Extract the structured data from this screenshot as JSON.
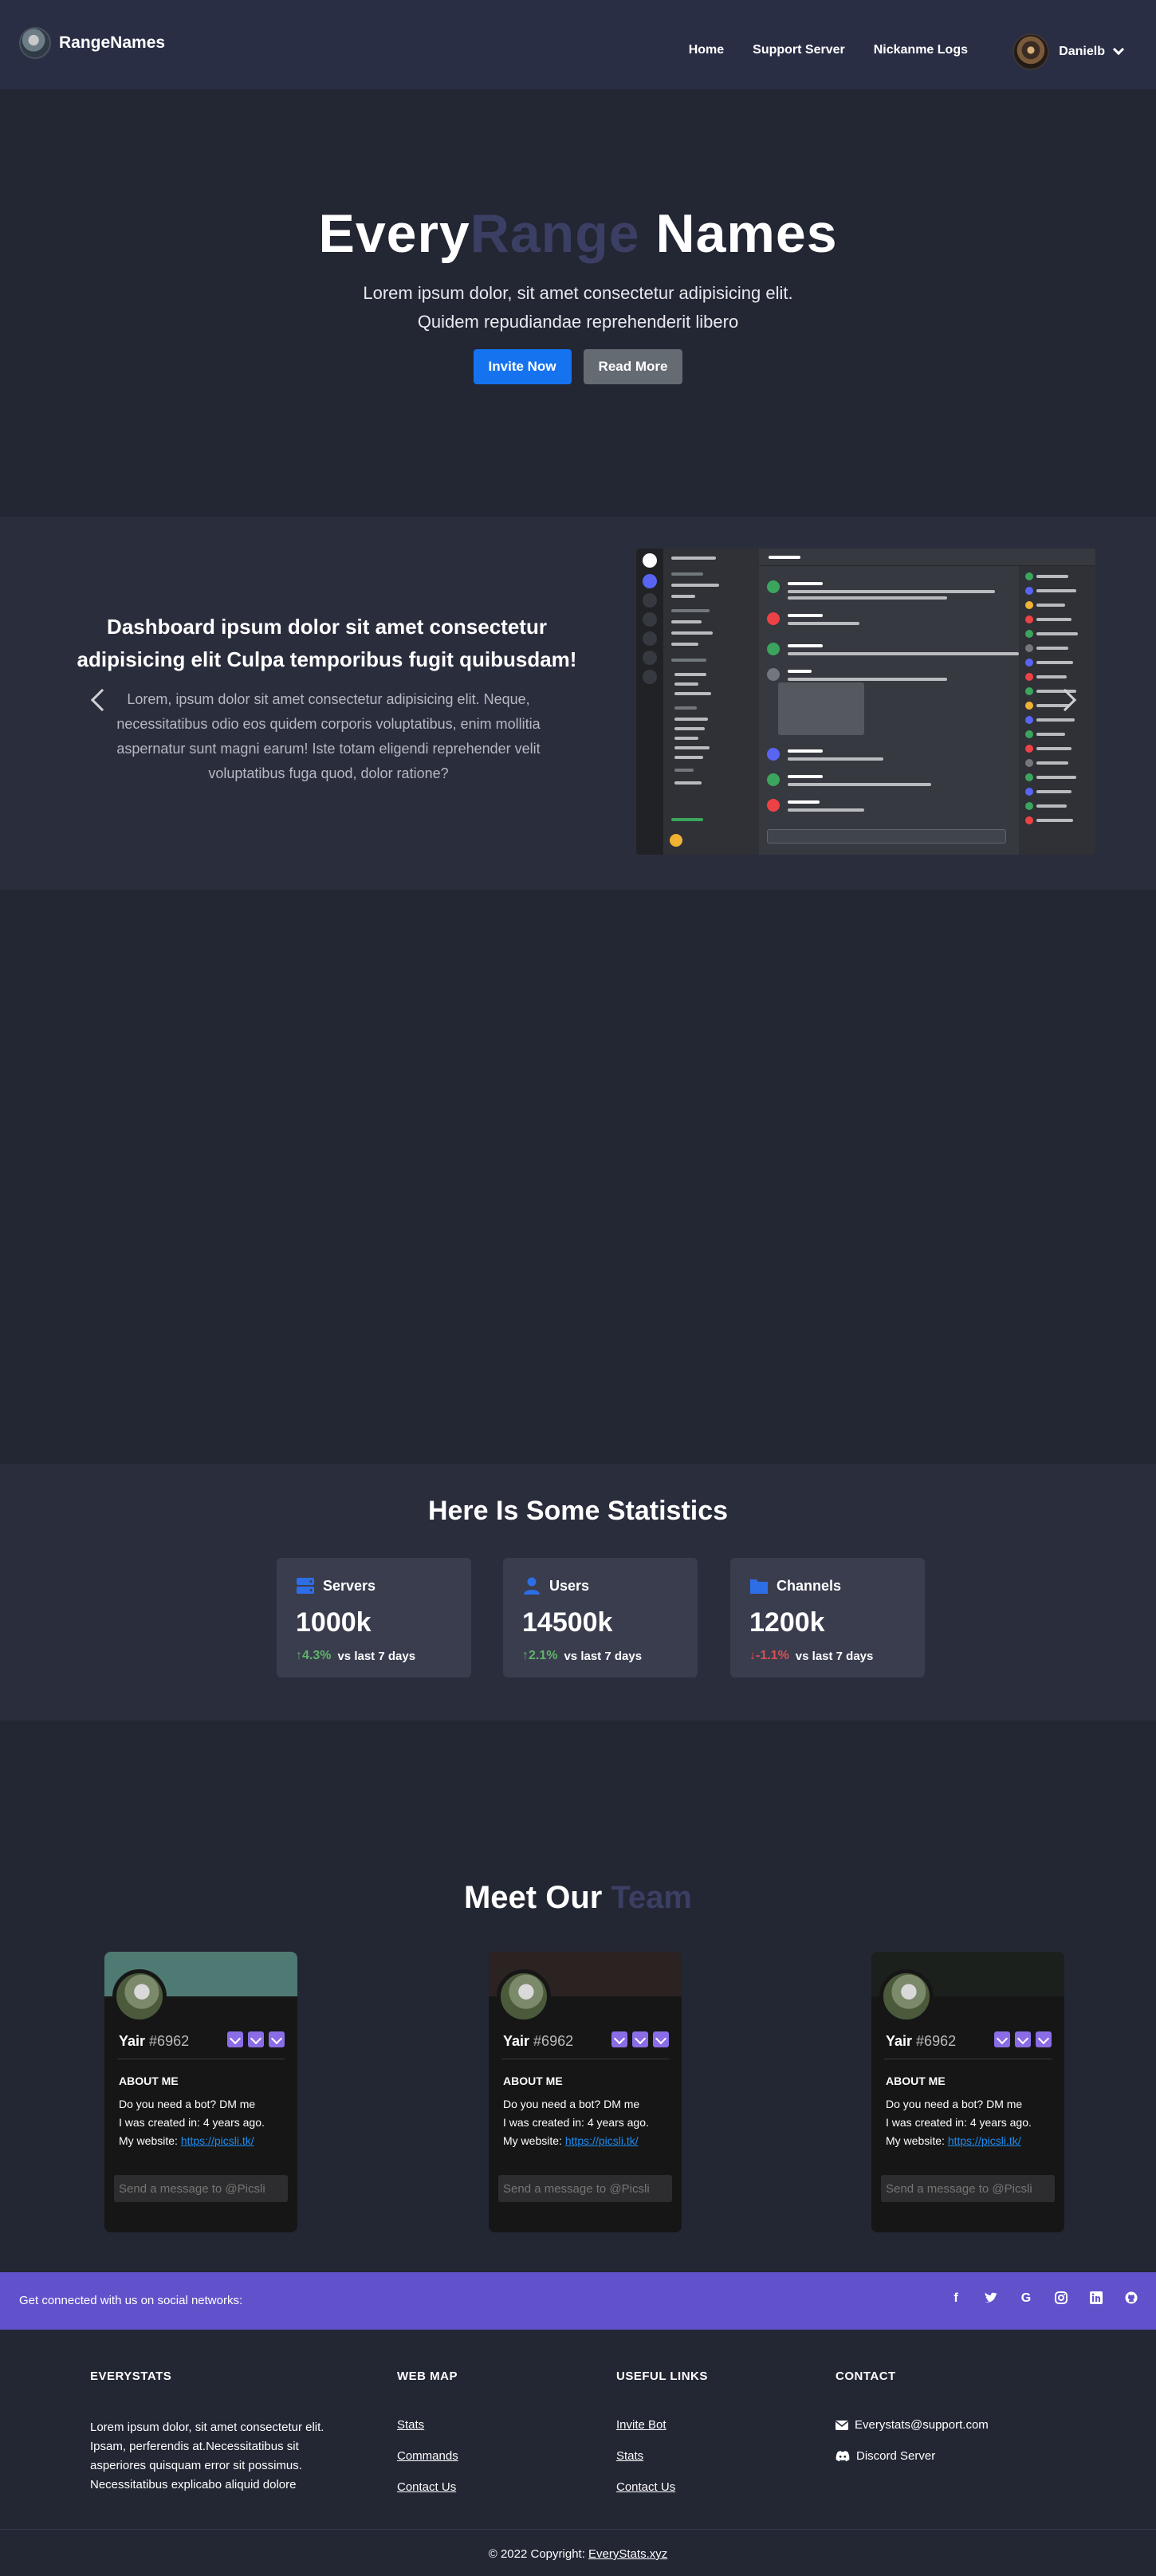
{
  "navbar": {
    "brand": "RangeNames",
    "links": [
      "Home",
      "Support Server",
      "Nickanme Logs"
    ],
    "user": "Danielb"
  },
  "hero": {
    "title_part1": "Every",
    "title_part2": "Range",
    "title_part3": "Names",
    "subtitle_line1": "Lorem ipsum dolor, sit amet consectetur adipisicing elit.",
    "subtitle_line2": "Quidem repudiandae reprehenderit libero",
    "invite_label": "Invite Now",
    "read_more_label": "Read More"
  },
  "carousel": {
    "heading": "Dashboard ipsum dolor sit amet consectetur adipisicing elit Culpa temporibus fugit quibusdam!",
    "text": "Lorem, ipsum dolor sit amet consectetur adipisicing elit. Neque, necessitatibus odio eos quidem corporis voluptatibus, enim mollitia aspernatur sunt magni earum! Iste totam eligendi reprehender velit voluptatibus fuga quod, dolor ratione?"
  },
  "stats": {
    "title": "Here Is Some Statistics",
    "cards": [
      {
        "label": "Servers",
        "value": "1000k",
        "change": "↑4.3%",
        "direction": "up",
        "period": "vs last 7 days",
        "icon": "server-icon"
      },
      {
        "label": "Users",
        "value": "14500k",
        "change": "↑2.1%",
        "direction": "up",
        "period": "vs last 7 days",
        "icon": "user-icon"
      },
      {
        "label": "Channels",
        "value": "1200k",
        "change": "↓-1.1%",
        "direction": "down",
        "period": "vs last 7 days",
        "icon": "folder-icon"
      }
    ]
  },
  "team": {
    "title_part1": "Meet Our",
    "title_part2": "Team",
    "members": [
      {
        "name": "Yair",
        "tag": "#6962",
        "about_title": "ABOUT ME",
        "line1": "Do you need a bot? DM me",
        "line2": "I was created in: 4 years ago.",
        "website_label": "My website:",
        "website": "https://picsli.tk/",
        "placeholder": "Send a message to @Picsli",
        "banner": "#4e7a73"
      },
      {
        "name": "Yair",
        "tag": "#6962",
        "about_title": "ABOUT ME",
        "line1": "Do you need a bot? DM me",
        "line2": "I was created in: 4 years ago.",
        "website_label": "My website:",
        "website": "https://picsli.tk/",
        "placeholder": "Send a message to @Picsli",
        "banner": "#2b2222"
      },
      {
        "name": "Yair",
        "tag": "#6962",
        "about_title": "ABOUT ME",
        "line1": "Do you need a bot? DM me",
        "line2": "I was created in: 4 years ago.",
        "website_label": "My website:",
        "website": "https://picsli.tk/",
        "placeholder": "Send a message to @Picsli",
        "banner": "#1c201d"
      }
    ]
  },
  "social": {
    "text": "Get connected with us on social networks:",
    "icons": [
      "facebook-icon",
      "twitter-icon",
      "google-icon",
      "instagram-icon",
      "linkedin-icon",
      "github-icon"
    ]
  },
  "footer": {
    "about_title": "EVERYSTATS",
    "about_text": "Lorem ipsum dolor, sit amet consectetur elit. Ipsam, perferendis at.Necessitatibus sit asperiores quisquam error sit possimus. Necessitatibus explicabo aliquid dolore",
    "webmap_title": "WEB MAP",
    "webmap_links": [
      "Stats",
      "Commands",
      "Contact Us"
    ],
    "useful_title": "USEFUL LINKS",
    "useful_links": [
      "Invite Bot",
      "Stats",
      "Contact Us"
    ],
    "contact_title": "CONTACT",
    "email": "Everystats@support.com",
    "discord": "Discord Server",
    "copyright": "© 2022 Copyright:",
    "copyright_link": "EveryStats.xyz"
  },
  "colors": {
    "navbar": "#2a2e45",
    "background": "#232633",
    "accent_muted": "#3b3f63",
    "primary_button": "#1573f0",
    "social_bar": "#6152cc",
    "up": "#5fb36a",
    "down": "#d94f4f"
  }
}
